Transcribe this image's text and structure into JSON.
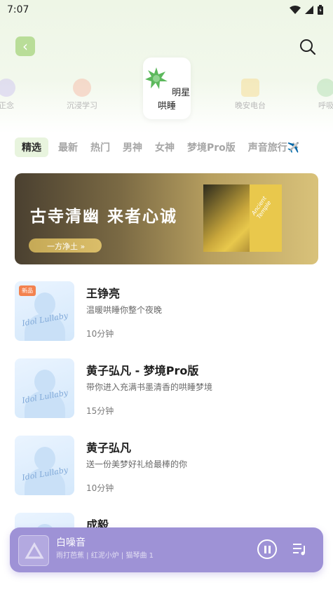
{
  "status_bar": {
    "time": "7:07"
  },
  "categories": [
    {
      "label": "正念",
      "icon": "flower-icon",
      "color": "#b6a9e6"
    },
    {
      "label": "沉浸学习",
      "icon": "target-icon",
      "color": "#f08a6a"
    },
    {
      "label": "明星哄睡",
      "icon": "star-icon",
      "color": "#5cb85c",
      "selected": true
    },
    {
      "label": "晚安电台",
      "icon": "radio-icon",
      "color": "#f3c44a"
    },
    {
      "label": "呼吸",
      "icon": "leaf-icon",
      "color": "#7bc67b"
    }
  ],
  "tabs": [
    "精选",
    "最新",
    "热门",
    "男神",
    "女神",
    "梦境Pro版",
    "声音旅行✈️"
  ],
  "banner": {
    "title": "古寺清幽 来者心诚",
    "pill": "一方净土 »",
    "sign_text": "Ancient Temple"
  },
  "items": [
    {
      "title": "王铮亮",
      "subtitle": "温暖哄睡你整个夜晚",
      "duration": "10分钟",
      "badge": "新品",
      "cover_text": "Idol Lullaby"
    },
    {
      "title": "黄子弘凡 - 梦境Pro版",
      "subtitle": "带你进入充满书墨清香的哄睡梦境",
      "duration": "15分钟",
      "cover_text": "Idol Lullaby"
    },
    {
      "title": "黄子弘凡",
      "subtitle": "送一份美梦好礼给最棒的你",
      "duration": "10分钟",
      "cover_text": "Idol Lullaby"
    },
    {
      "title": "成毅",
      "subtitle": "",
      "duration": "",
      "cover_text": ""
    }
  ],
  "player": {
    "title": "白噪音",
    "subtitle": "雨打芭蕉 | 红泥小炉 | 猫琴曲 1"
  }
}
